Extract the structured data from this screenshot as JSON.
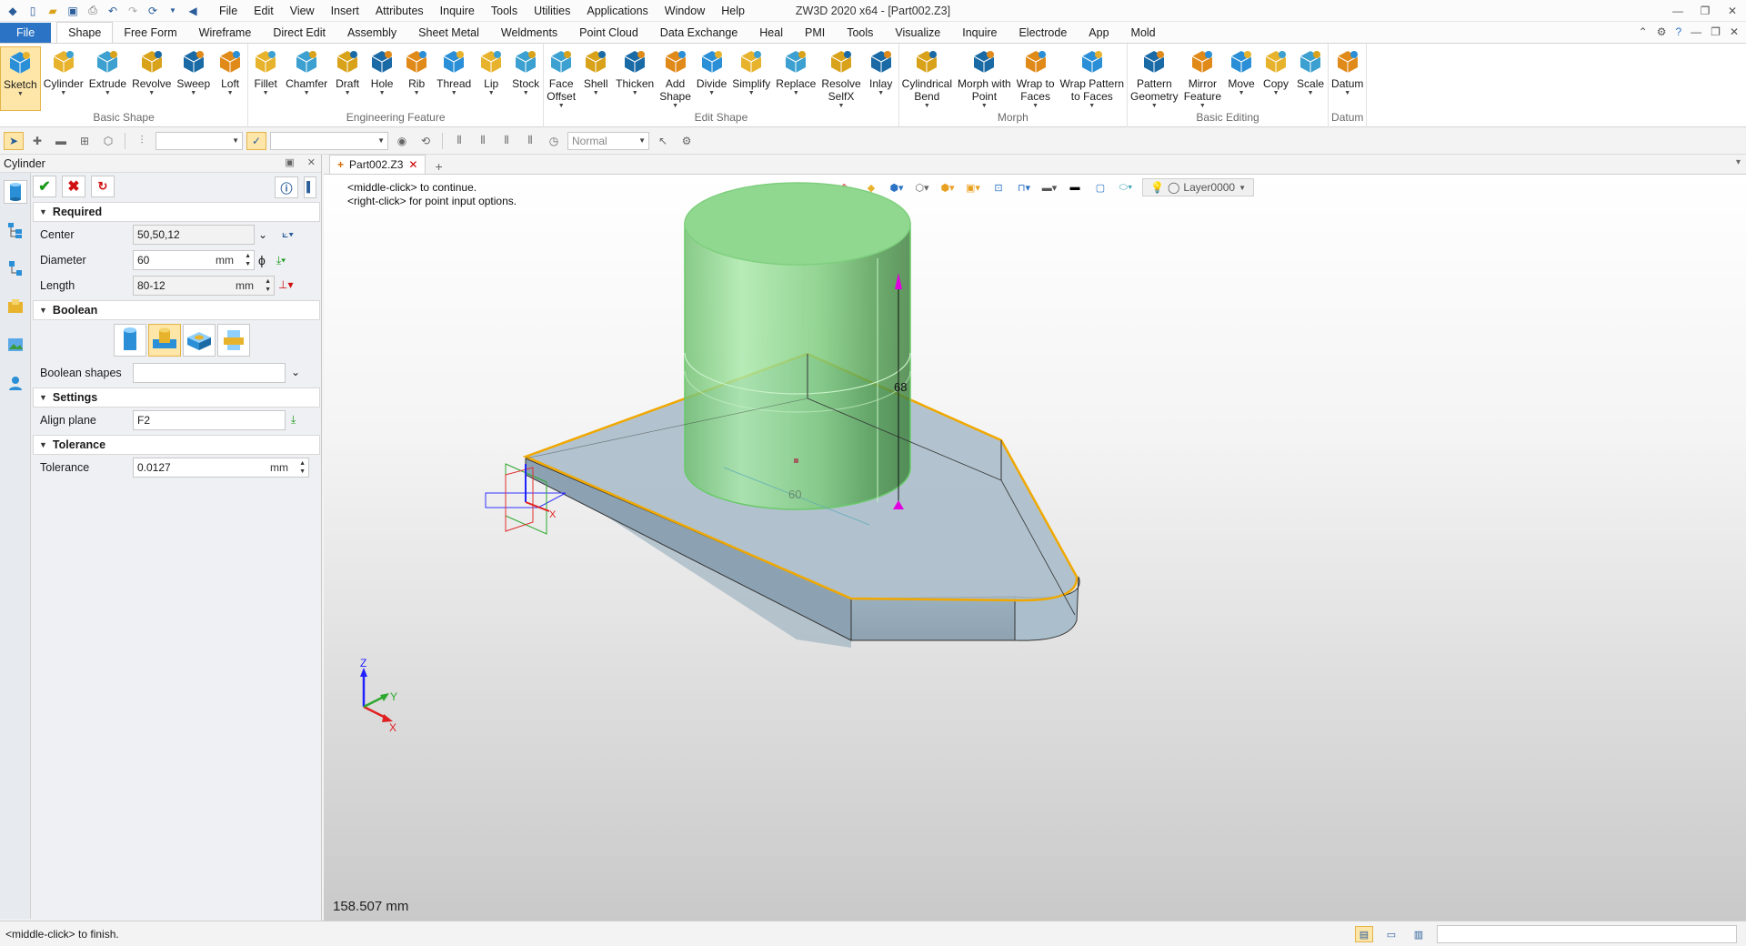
{
  "window": {
    "title": "ZW3D 2020 x64 - [Part002.Z3]",
    "menu": [
      "File",
      "Edit",
      "View",
      "Insert",
      "Attributes",
      "Inquire",
      "Tools",
      "Utilities",
      "Applications",
      "Window",
      "Help"
    ]
  },
  "ribbon_tabs": [
    "File",
    "Shape",
    "Free Form",
    "Wireframe",
    "Direct Edit",
    "Assembly",
    "Sheet Metal",
    "Weldments",
    "Point Cloud",
    "Data Exchange",
    "Heal",
    "PMI",
    "Tools",
    "Visualize",
    "Inquire",
    "Electrode",
    "App",
    "Mold"
  ],
  "active_ribbon_tab": "Shape",
  "ribbon_groups": [
    {
      "label": "Basic Shape",
      "items": [
        {
          "l1": "Sketch",
          "l2": "",
          "icon": "sketch-icon",
          "sel": true
        },
        {
          "l1": "Cylinder",
          "l2": "",
          "icon": "cylinder-icon"
        },
        {
          "l1": "Extrude",
          "l2": "",
          "icon": "extrude-icon"
        },
        {
          "l1": "Revolve",
          "l2": "",
          "icon": "revolve-icon"
        },
        {
          "l1": "Sweep",
          "l2": "",
          "icon": "sweep-icon"
        },
        {
          "l1": "Loft",
          "l2": "",
          "icon": "loft-icon"
        }
      ]
    },
    {
      "label": "Engineering Feature",
      "items": [
        {
          "l1": "Fillet",
          "l2": "",
          "icon": "fillet-icon"
        },
        {
          "l1": "Chamfer",
          "l2": "",
          "icon": "chamfer-icon"
        },
        {
          "l1": "Draft",
          "l2": "",
          "icon": "draft-icon"
        },
        {
          "l1": "Hole",
          "l2": "",
          "icon": "hole-icon"
        },
        {
          "l1": "Rib",
          "l2": "",
          "icon": "rib-icon"
        },
        {
          "l1": "Thread",
          "l2": "",
          "icon": "thread-icon"
        },
        {
          "l1": "Lip",
          "l2": "",
          "icon": "lip-icon"
        },
        {
          "l1": "Stock",
          "l2": "",
          "icon": "stock-icon"
        }
      ]
    },
    {
      "label": "Edit Shape",
      "items": [
        {
          "l1": "Face",
          "l2": "Offset",
          "icon": "face-offset-icon"
        },
        {
          "l1": "Shell",
          "l2": "",
          "icon": "shell-icon"
        },
        {
          "l1": "Thicken",
          "l2": "",
          "icon": "thicken-icon"
        },
        {
          "l1": "Add",
          "l2": "Shape",
          "icon": "add-shape-icon"
        },
        {
          "l1": "Divide",
          "l2": "",
          "icon": "divide-icon"
        },
        {
          "l1": "Simplify",
          "l2": "",
          "icon": "simplify-icon"
        },
        {
          "l1": "Replace",
          "l2": "",
          "icon": "replace-icon"
        },
        {
          "l1": "Resolve",
          "l2": "SelfX",
          "icon": "resolve-selfx-icon"
        },
        {
          "l1": "Inlay",
          "l2": "",
          "icon": "inlay-icon"
        }
      ]
    },
    {
      "label": "Morph",
      "items": [
        {
          "l1": "Cylindrical",
          "l2": "Bend",
          "icon": "cylindrical-bend-icon"
        },
        {
          "l1": "Morph with",
          "l2": "Point",
          "icon": "morph-point-icon"
        },
        {
          "l1": "Wrap to",
          "l2": "Faces",
          "icon": "wrap-faces-icon"
        },
        {
          "l1": "Wrap Pattern",
          "l2": "to Faces",
          "icon": "wrap-pattern-icon"
        }
      ]
    },
    {
      "label": "Basic Editing",
      "items": [
        {
          "l1": "Pattern",
          "l2": "Geometry",
          "icon": "pattern-geometry-icon"
        },
        {
          "l1": "Mirror",
          "l2": "Feature",
          "icon": "mirror-feature-icon"
        },
        {
          "l1": "Move",
          "l2": "",
          "icon": "move-icon"
        },
        {
          "l1": "Copy",
          "l2": "",
          "icon": "copy-icon"
        },
        {
          "l1": "Scale",
          "l2": "",
          "icon": "scale-icon"
        }
      ]
    },
    {
      "label": "Datum",
      "items": [
        {
          "l1": "Datum",
          "l2": "",
          "icon": "datum-icon"
        }
      ]
    }
  ],
  "toolbar": {
    "render_mode": "Normal"
  },
  "panel": {
    "title": "Cylinder",
    "sections": {
      "required": "Required",
      "boolean": "Boolean",
      "settings": "Settings",
      "tolerance": "Tolerance"
    },
    "fields": {
      "center_label": "Center",
      "center_value": "50,50,12",
      "diameter_label": "Diameter",
      "diameter_value": "60",
      "diameter_unit": "mm",
      "length_label": "Length",
      "length_value": "80-12",
      "length_unit": "mm",
      "boolean_shapes_label": "Boolean shapes",
      "boolean_shapes_value": "",
      "align_plane_label": "Align plane",
      "align_plane_value": "F2",
      "tolerance_label": "Tolerance",
      "tolerance_value": "0.0127",
      "tolerance_unit": "mm"
    }
  },
  "document_tab": "Part002.Z3",
  "viewport": {
    "prompt_line1": "<middle-click> to continue.",
    "prompt_line2": "<right-click> for point input options.",
    "layer": "Layer0000",
    "dim_length": "68",
    "dim_diameter": "60",
    "distance_readout": "158.507 mm",
    "axis_x": "X",
    "axis_y": "Y",
    "axis_z": "Z"
  },
  "status": {
    "message": "<middle-click> to finish."
  },
  "colors": {
    "accent": "#2a73c5",
    "cylinder_fill": "#8fd88f",
    "base_fill": "#9fb4c2",
    "highlight_edge": "#f0a800",
    "handle": "#e000e0"
  }
}
